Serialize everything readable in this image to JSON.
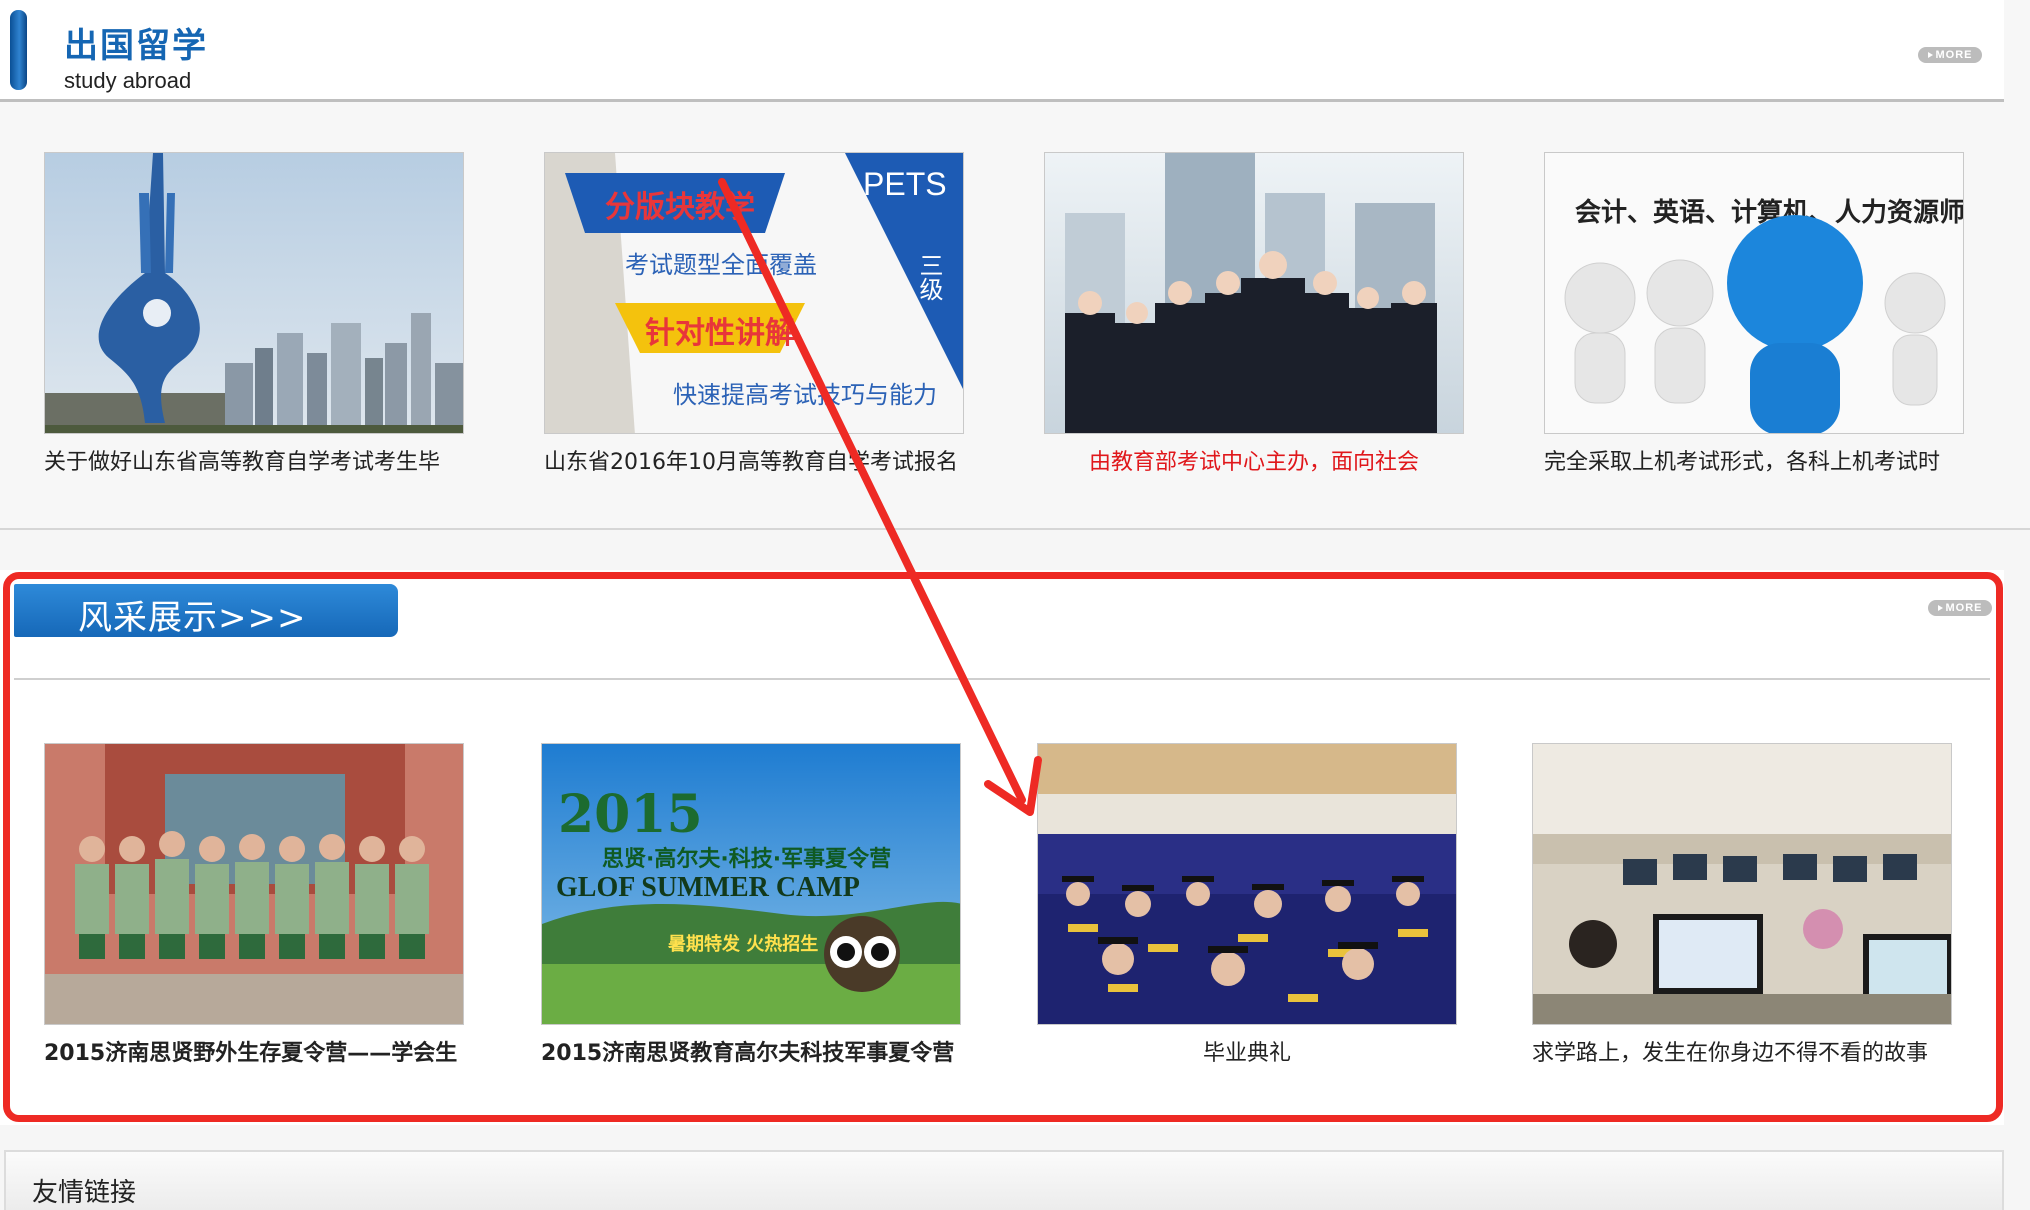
{
  "study_abroad": {
    "title": "出国留学",
    "subtitle": "study abroad",
    "more_label": "MORE",
    "items": [
      {
        "caption": "关于做好山东省高等教育自学考试考生毕",
        "highlight": false
      },
      {
        "caption": "山东省2016年10月高等教育自学考试报名",
        "highlight": false,
        "image_text": {
          "a": "分版块教学",
          "b": "考试题型全面覆盖",
          "c": "针对性讲解",
          "d": "快速提高考试技巧与能力",
          "e": "PETS",
          "f": "三级"
        }
      },
      {
        "caption": "由教育部考试中心主办，面向社会",
        "highlight": true
      },
      {
        "caption": "完全采取上机考试形式，各科上机考试时",
        "highlight": false,
        "image_text": {
          "a": "会计、英语、计算机、人力资源师..."
        }
      }
    ]
  },
  "showcase": {
    "title": "风采展示>>>",
    "more_label": "MORE",
    "items": [
      {
        "caption": "2015济南思贤野外生存夏令营——学会生"
      },
      {
        "caption": "2015济南思贤教育高尔夫科技军事夏令营",
        "image_text": {
          "a": "2015",
          "b": "思贤·高尔夫·科技·军事夏令营",
          "c": "GLOF SUMMER CAMP",
          "d": "暑期特发 火热招生"
        }
      },
      {
        "caption": "毕业典礼"
      },
      {
        "caption": "求学路上，发生在你身边不得不看的故事"
      }
    ]
  },
  "friend_links": {
    "title": "友情链接"
  },
  "colors": {
    "brand_blue": "#1566b3",
    "highlight_red": "#e0171b",
    "annotation_red": "#ee2a24"
  }
}
